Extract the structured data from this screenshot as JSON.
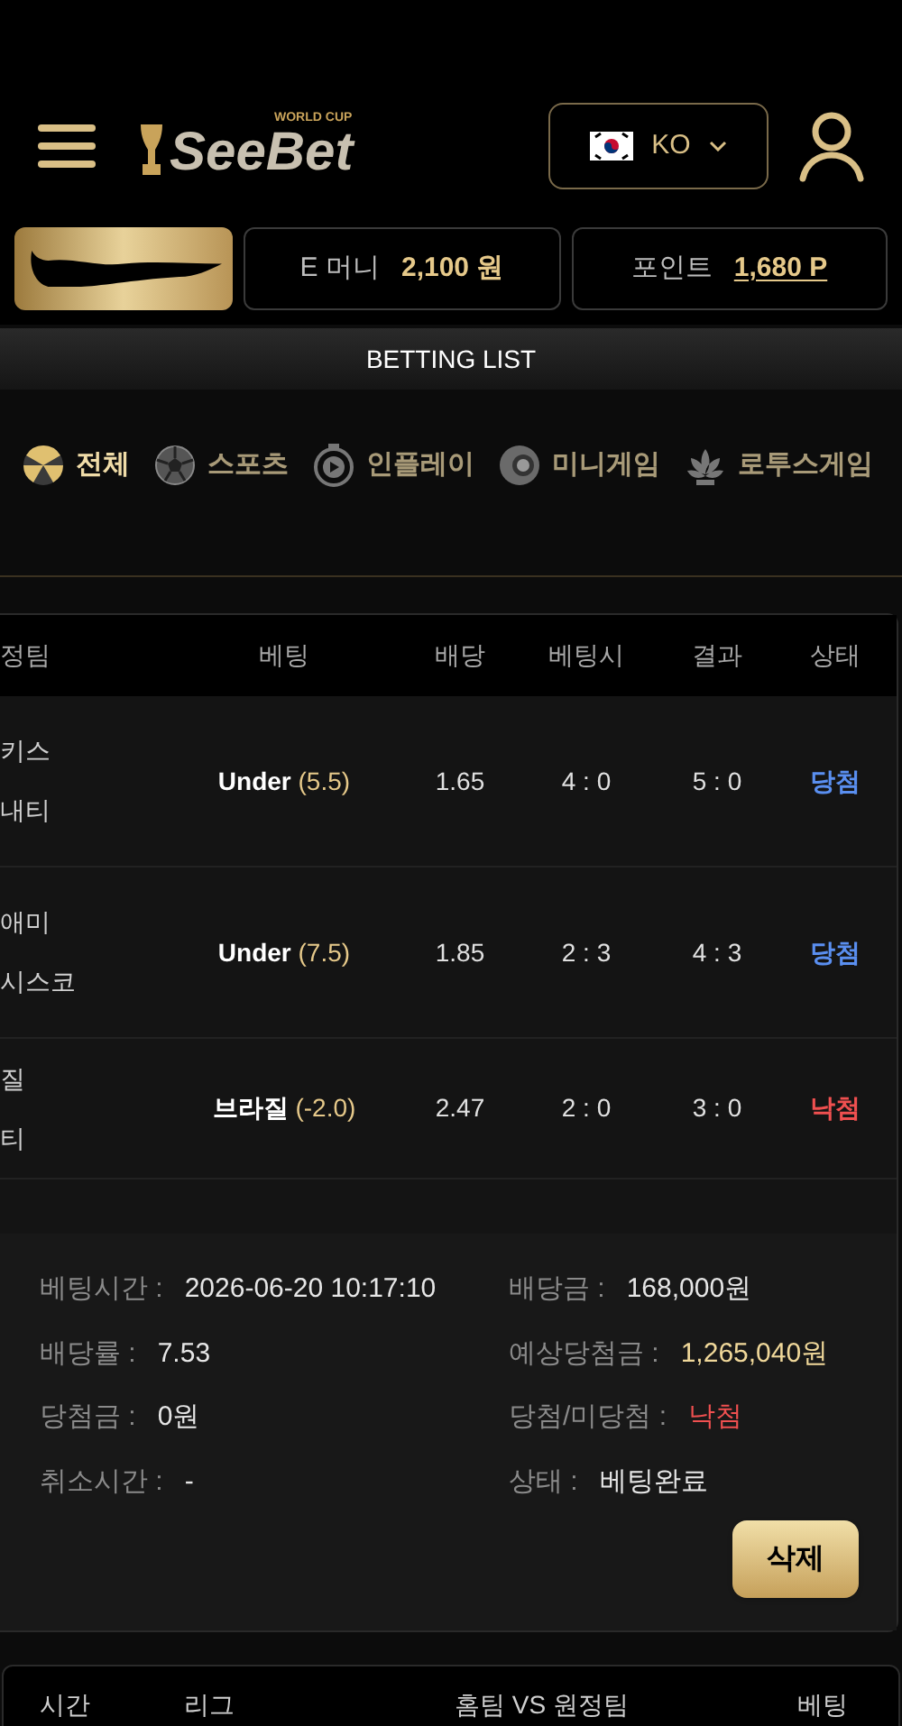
{
  "logo": {
    "tag": "WORLD CUP",
    "text": "SeeBet"
  },
  "language": {
    "code": "KO"
  },
  "balances": [
    {
      "label": "E 머니",
      "value": "2,100 원",
      "underlined": false
    },
    {
      "label": "포인트",
      "value": "1,680 P",
      "underlined": true
    }
  ],
  "page_title": "BETTING LIST",
  "tabs": [
    {
      "label": "전체",
      "kind": "all",
      "selected": true
    },
    {
      "label": "스포츠",
      "kind": "sports",
      "selected": false
    },
    {
      "label": "인플레이",
      "kind": "inplay",
      "selected": false
    },
    {
      "label": "미니게임",
      "kind": "mini",
      "selected": false
    },
    {
      "label": "로투스게임",
      "kind": "lotus",
      "selected": false
    }
  ],
  "bet_table": {
    "columns": [
      "정팀",
      "베팅",
      "배당",
      "베팅시",
      "결과",
      "상태"
    ],
    "rows": [
      {
        "teams": [
          "키스",
          "내티"
        ],
        "pick": "Under",
        "line": "(5.5)",
        "odds": "1.65",
        "score_at_bet": "4 : 0",
        "result": "5 : 0",
        "status": "당첨",
        "won": true
      },
      {
        "teams": [
          "애미",
          "시스코"
        ],
        "pick": "Under",
        "line": "(7.5)",
        "odds": "1.85",
        "score_at_bet": "2 : 3",
        "result": "4 : 3",
        "status": "당첨",
        "won": true
      },
      {
        "teams": [
          "질",
          "티"
        ],
        "pick": "브라질",
        "line": "(-2.0)",
        "odds": "2.47",
        "score_at_bet": "2 : 0",
        "result": "3 : 0",
        "status": "낙첨",
        "won": false
      }
    ]
  },
  "summary": [
    {
      "label": "베팅시간 :",
      "value": "2026-06-20 10:17:10",
      "color": "#e6e6e6"
    },
    {
      "label": "배당금 :",
      "value": "168,000원",
      "color": "#e6e6e6"
    },
    {
      "label": "배당률 :",
      "value": "7.53",
      "color": "#e6e6e6"
    },
    {
      "label": "예상당첨금 :",
      "value": "1,265,040원",
      "color": "#f0d89a"
    },
    {
      "label": "당첨금 :",
      "value": "0원",
      "color": "#e6e6e6"
    },
    {
      "label": "당첨/미당첨 :",
      "value": "낙첨",
      "color": "#f05050"
    },
    {
      "label": "취소시간 :",
      "value": "-",
      "color": "#e6e6e6"
    },
    {
      "label": "상태 :",
      "value": "베팅완료",
      "color": "#e6e6e6"
    }
  ],
  "delete_button": "삭제",
  "next_table": {
    "columns": [
      "시간",
      "리그",
      "홈팀 VS 원정팀",
      "베팅"
    ]
  }
}
